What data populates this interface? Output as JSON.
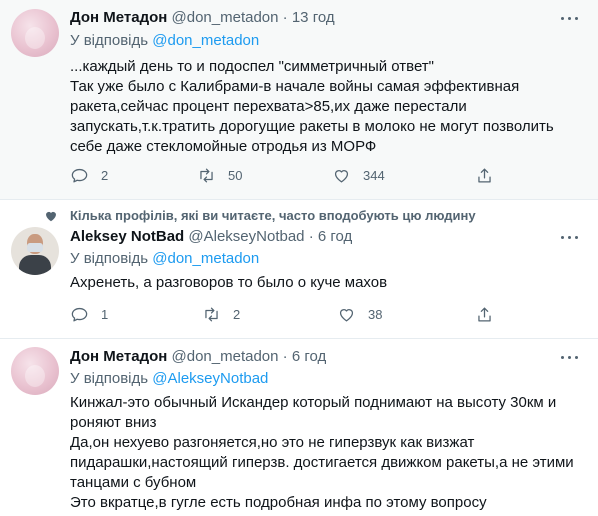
{
  "tweets": [
    {
      "name": "Дон Метадон",
      "handle": "@don_metadon",
      "sep": "·",
      "time": "13 год",
      "reply_prefix": "У відповідь",
      "reply_to": "@don_metadon",
      "lines": [
        "...каждый день то и подоспел \"симметричный ответ\"",
        "Так уже было с Калибрами-в начале войны самая эффективная",
        "ракета,сейчас процент перехвата>85,их даже перестали",
        "запускать,т.к.тратить дорогущие ракеты в молоко не могут позволить",
        "себе даже стекломойные отродья из МОРФ"
      ],
      "replies": "2",
      "retweets": "50",
      "likes": "344"
    },
    {
      "social_context": "Кілька профілів, які ви читаєте, часто вподобують цю людину",
      "name": "Aleksey NotBad",
      "handle": "@AlekseyNotbad",
      "sep": "·",
      "time": "6 год",
      "reply_prefix": "У відповідь",
      "reply_to": "@don_metadon",
      "lines": [
        "Ахренеть, а разговоров то было о куче махов"
      ],
      "replies": "1",
      "retweets": "2",
      "likes": "38"
    },
    {
      "name": "Дон Метадон",
      "handle": "@don_metadon",
      "sep": "·",
      "time": "6 год",
      "reply_prefix": "У відповідь",
      "reply_to": "@AlekseyNotbad",
      "lines": [
        "Кинжал-это обычный Искандер который поднимают на высоту 30км и",
        "роняют вниз",
        "Да,он нехуево разгоняется,но это не гиперзвук как визжат",
        "пидарашки,настоящий гиперзв. достигается движком ракеты,а не этими",
        "танцами с бубном",
        "Это вкратце,в гугле есть подробная инфа по этому вопросу"
      ]
    }
  ],
  "icons": {
    "reply": "reply-icon",
    "retweet": "retweet-icon",
    "like": "heart-icon",
    "share": "share-icon",
    "more": "more-icon",
    "social": "heart-filled-icon"
  },
  "colors": {
    "text": "#0f1419",
    "muted": "#536471",
    "link": "#1d9bf0",
    "highlight_bg": "#f7f9f9",
    "divider": "#e6ecf0"
  }
}
